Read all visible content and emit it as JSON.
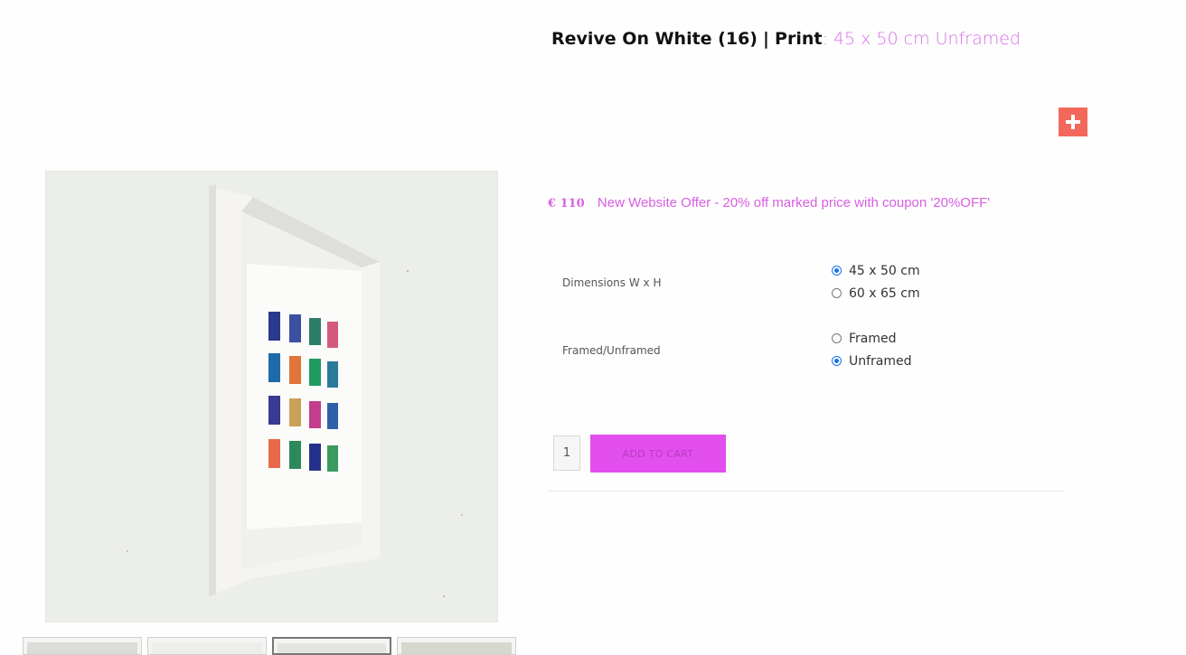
{
  "product": {
    "name": "Revive On White (16)",
    "separator": "|",
    "type_label": "Print",
    "variant_prefix": ":",
    "variant": "45 x 50 cm Unframed"
  },
  "plus_button": {
    "icon": "plus-icon",
    "color": "#f2695c"
  },
  "pricing": {
    "price": "€ 110",
    "offer": "New Website Offer - 20% off marked price with coupon '20%OFF'",
    "accent_color": "#d760e0"
  },
  "options": {
    "dimensions": {
      "label": "Dimensions W x H",
      "choices": [
        {
          "label": "45 x 50 cm",
          "checked": true
        },
        {
          "label": "60 x 65 cm",
          "checked": false
        }
      ]
    },
    "framing": {
      "label": "Framed/Unframed",
      "choices": [
        {
          "label": "Framed",
          "checked": false
        },
        {
          "label": "Unframed",
          "checked": true
        }
      ]
    }
  },
  "cart": {
    "quantity": "1",
    "add_label": "ADD TO CART",
    "button_color": "#e34fee"
  },
  "gallery": {
    "thumbnail_count": 4,
    "active_thumbnail": 3
  }
}
